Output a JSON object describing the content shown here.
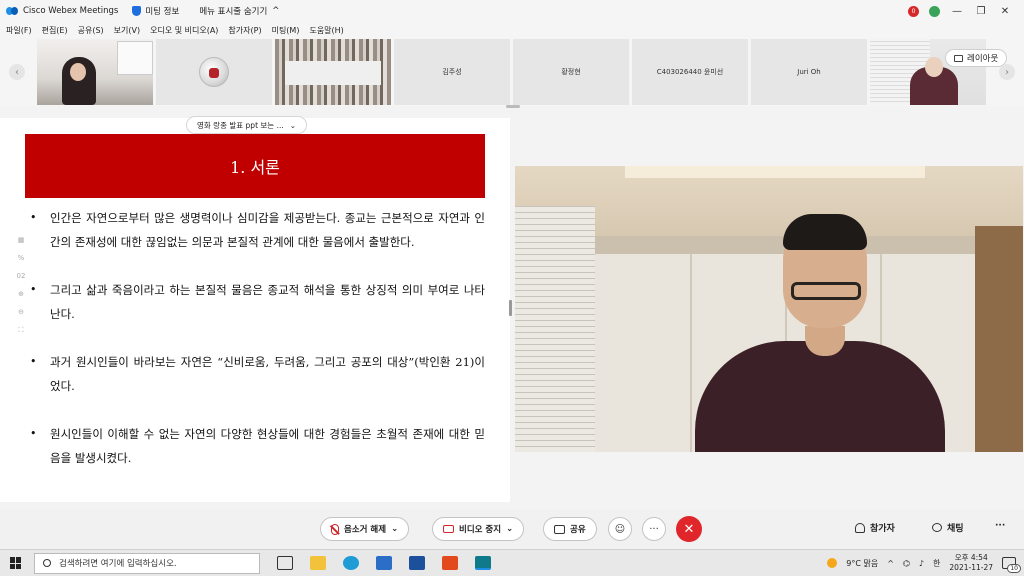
{
  "titlebar": {
    "app_title": "Cisco Webex Meetings",
    "meeting_info": "미팅 정보",
    "hide_menu": "메뉴 표시줄 숨기기",
    "rec_badge": "0"
  },
  "menu": [
    "파일(F)",
    "편집(E)",
    "공유(S)",
    "보기(V)",
    "오디오 및 비디오(A)",
    "참가자(P)",
    "미팅(M)",
    "도움말(H)"
  ],
  "participants": [
    {
      "name": "",
      "kind": "video"
    },
    {
      "name": "",
      "kind": "avatar"
    },
    {
      "name": "",
      "kind": "video"
    },
    {
      "name": "김주성",
      "kind": "name"
    },
    {
      "name": "황정현",
      "kind": "name"
    },
    {
      "name": "C403026440 윤미선",
      "kind": "name"
    },
    {
      "name": "Juri Oh",
      "kind": "name"
    },
    {
      "name": "",
      "kind": "video"
    }
  ],
  "layout_button": "레이아웃",
  "share_tab": "영화 랑종 발표 ppt 보는 ...",
  "slide": {
    "title": "1. 서론",
    "page_indicator": "02",
    "bullets": [
      "인간은 자연으로부터 많은 생명력이나 심미감을 제공받는다. 종교는 근본적으로 자연과 인간의 존재성에 대한 끊임없는 의문과 본질적 관계에 대한 물음에서 출발한다.",
      "그리고 삶과 죽음이라고 하는 본질적 물음은 종교적 해석을 통한 상징적 의미 부여로 나타난다.",
      "과거 원시인들이 바라보는 자연은 “신비로움, 두려움, 그리고 공포의 대상”(박인환 21)이었다.",
      "원시인들이 이해할 수 없는 자연의 다양한 현상들에 대한 경험들은 초월적 존재에 대한 믿음을 발생시켰다."
    ]
  },
  "controls": {
    "unmute": "음소거 해제",
    "stop_video": "비디오 중지",
    "share": "공유",
    "participants": "참가자",
    "chat": "채팅"
  },
  "taskbar": {
    "search_placeholder": "검색하려면 여기에 입력하십시오.",
    "weather": "9°C 맑음",
    "ime": "한",
    "time": "오후 4:54",
    "date": "2021-11-27",
    "notifications": "10"
  }
}
